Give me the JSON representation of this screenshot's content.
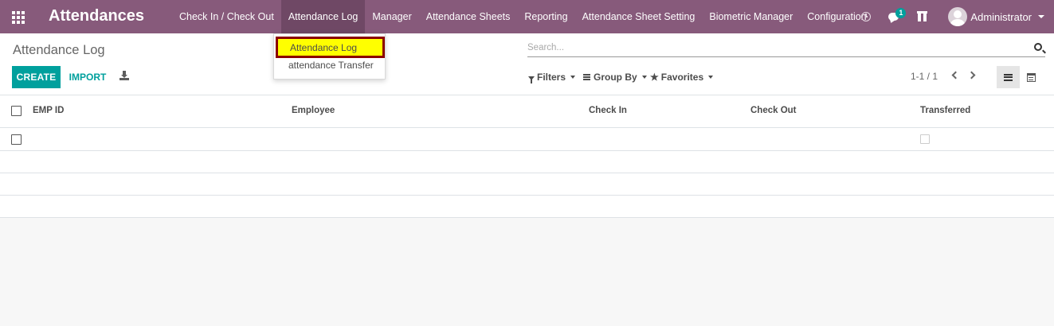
{
  "app": {
    "title": "Attendances"
  },
  "menu": {
    "items": [
      {
        "label": "Check In / Check Out"
      },
      {
        "label": "Attendance Log"
      },
      {
        "label": "Manager"
      },
      {
        "label": "Attendance Sheets"
      },
      {
        "label": "Reporting"
      },
      {
        "label": "Attendance Sheet Setting"
      },
      {
        "label": "Biometric Manager"
      },
      {
        "label": "Configuration"
      }
    ],
    "active": "Attendance Log"
  },
  "systray": {
    "messages_count": "1",
    "user": "Administrator",
    "icons": [
      "clock-icon",
      "chat-icon",
      "gift-icon"
    ]
  },
  "dropdown": {
    "items": [
      {
        "label": "Attendance Log"
      },
      {
        "label": "attendance Transfer"
      }
    ],
    "highlight_color": "#ffff00",
    "highlight_border": "#8b0000"
  },
  "control_panel": {
    "title": "Attendance Log",
    "create_label": "CREATE",
    "import_label": "IMPORT",
    "search_placeholder": "Search...",
    "filters_label": "Filters",
    "groupby_label": "Group By",
    "favorites_label": "Favorites",
    "pager": "1-1 / 1"
  },
  "table": {
    "columns": [
      "EMP ID",
      "Employee",
      "Check In",
      "Check Out",
      "Transferred"
    ],
    "rows": [
      {
        "emp_id": "",
        "employee": "",
        "check_in": "",
        "check_out": "",
        "transferred": false
      }
    ]
  },
  "colors": {
    "brand": "#875a7b",
    "active_menu": "#6f4865",
    "primary": "#00a09d"
  }
}
